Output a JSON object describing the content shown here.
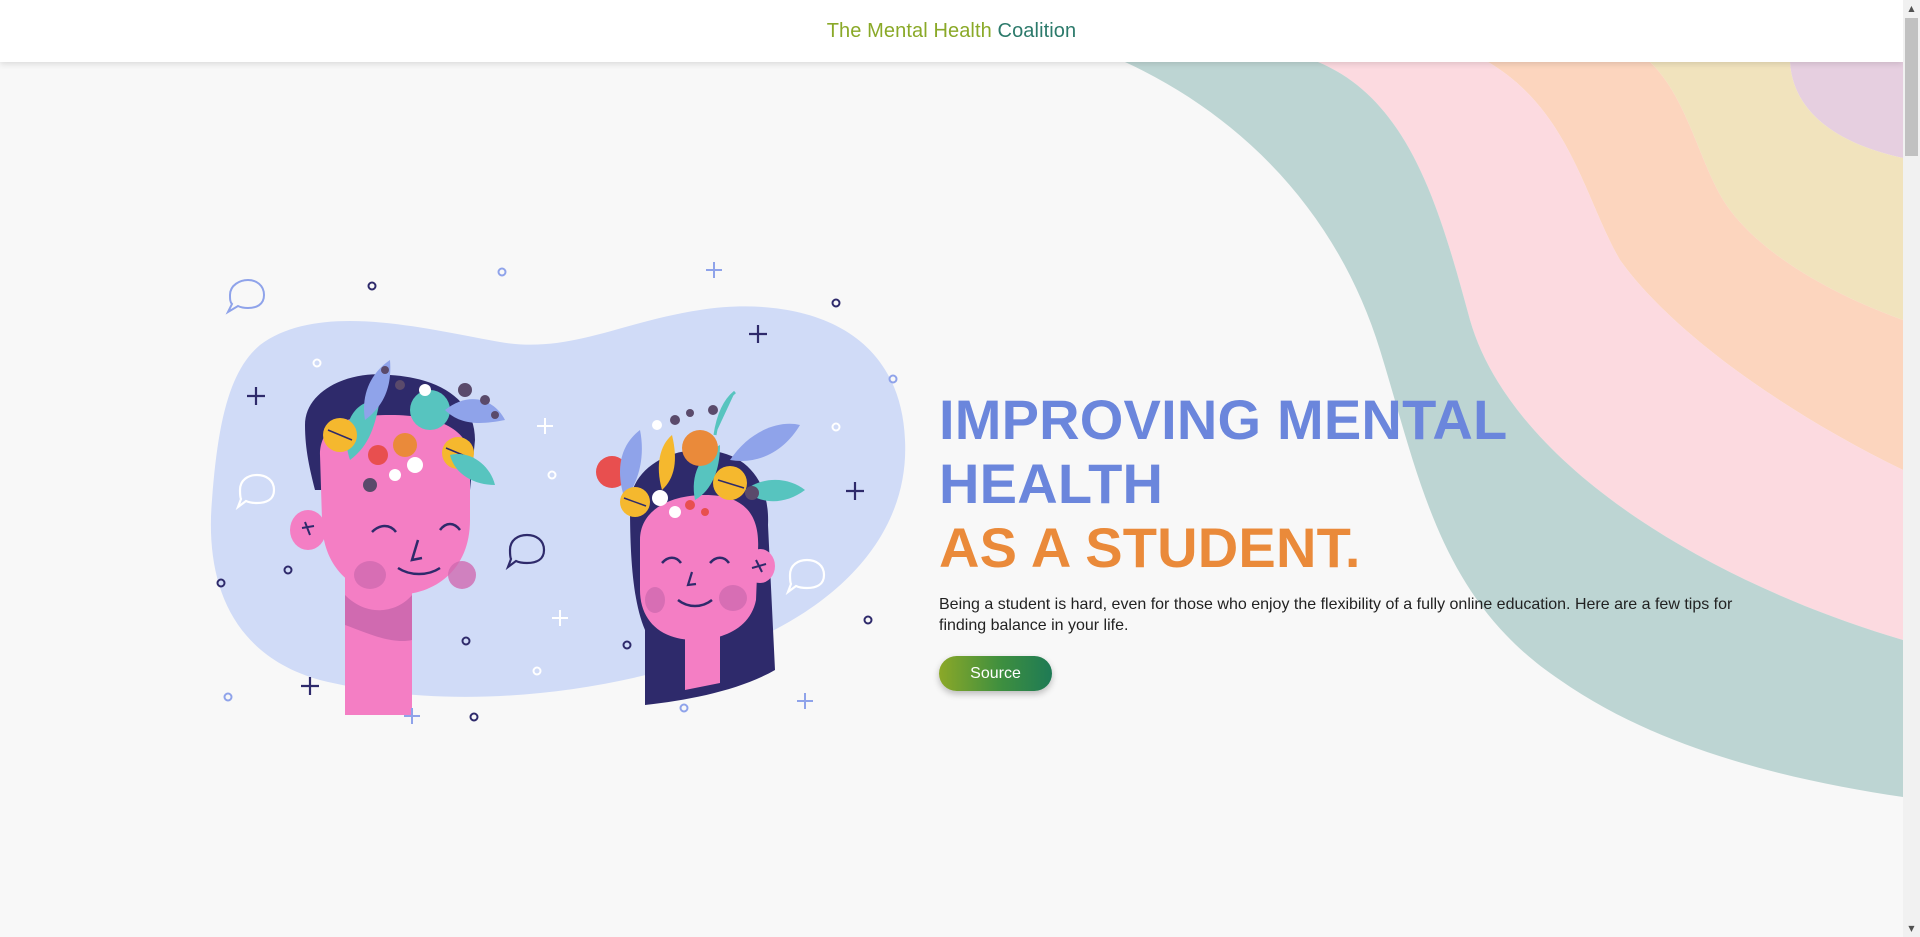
{
  "header": {
    "brand_part_1": "The Mental Health",
    "brand_part_2": "Coalition"
  },
  "hero": {
    "headline_line_1": "IMPROVING MENTAL HEALTH",
    "headline_line_2": "AS A STUDENT.",
    "description": "Being a student is hard, even for those who enjoy the flexibility of a fully online education. Here are a few tips for finding balance in your life.",
    "source_label": "Source"
  },
  "colors": {
    "brand_green": "#8aa928",
    "brand_teal": "#2c7a6b",
    "headline_blue": "#6b86dc",
    "headline_orange": "#ea8a3a",
    "wave_teal": "#bdd5d3",
    "wave_pink": "#fcdae0",
    "wave_peach": "#fcd5be",
    "wave_yellow": "#f1e3bd",
    "wave_lilac": "#e6cfe0",
    "blob_blue": "#d0dbf7",
    "face_pink": "#f47ec4",
    "hair_navy": "#2e2a6b"
  },
  "icons": {
    "speech_bubble": "speech-bubble-icon",
    "plus": "plus-icon",
    "circle": "circle-dot-icon"
  },
  "scrollbar": {
    "up": "▲",
    "down": "▼"
  }
}
